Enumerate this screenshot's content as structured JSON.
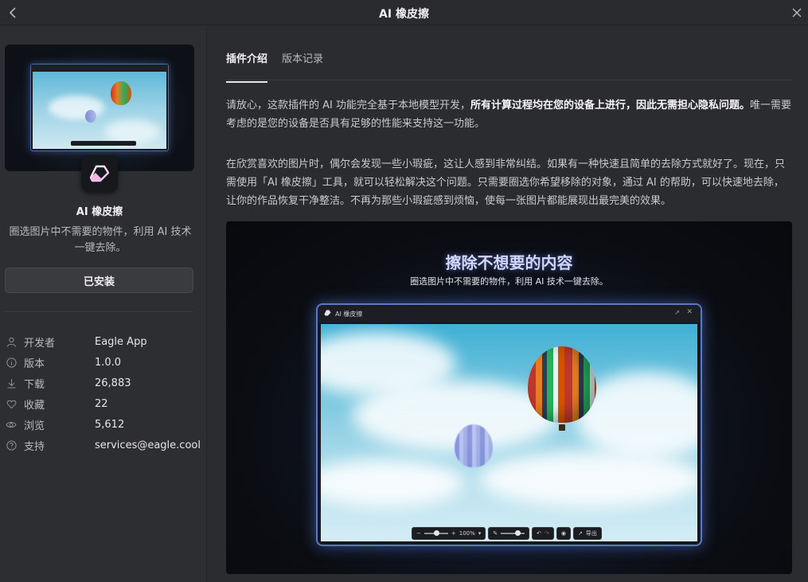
{
  "window": {
    "title": "AI 橡皮擦",
    "back_icon": "chevron-left-icon",
    "close_icon": "close-icon"
  },
  "sidebar": {
    "app_name": "AI 橡皮擦",
    "app_description": "圈选图片中不需要的物件，利用 AI 技术一键去除。",
    "install_button_label": "已安装",
    "info": [
      {
        "icon": "user-icon",
        "label": "开发者",
        "value": "Eagle App"
      },
      {
        "icon": "info-icon",
        "label": "版本",
        "value": "1.0.0"
      },
      {
        "icon": "download-icon",
        "label": "下载",
        "value": "26,883"
      },
      {
        "icon": "heart-icon",
        "label": "收藏",
        "value": "22"
      },
      {
        "icon": "eye-icon",
        "label": "浏览",
        "value": "5,612"
      },
      {
        "icon": "help-icon",
        "label": "支持",
        "value": "services@eagle.cool"
      }
    ]
  },
  "main": {
    "tabs": [
      {
        "label": "插件介绍",
        "active": true
      },
      {
        "label": "版本记录",
        "active": false
      }
    ],
    "paragraph1_before": "请放心，这款插件的 AI 功能完全基于本地模型开发，",
    "paragraph1_bold": "所有计算过程均在您的设备上进行，因此无需担心隐私问题。",
    "paragraph1_after": "唯一需要考虑的是您的设备是否具有足够的性能来支持这一功能。",
    "paragraph2": "在欣赏喜欢的图片时，偶尔会发现一些小瑕疵，这让人感到非常纠结。如果有一种快速且简单的去除方式就好了。现在，只需使用「AI 橡皮擦」工具，就可以轻松解决这个问题。只需要圈选你希望移除的对象，通过 AI 的帮助，可以快速地去除，让你的作品恢复干净整洁。不再为那些小瑕疵感到烦恼，使每一张图片都能展现出最完美的效果。",
    "promo": {
      "title": "擦除不想要的内容",
      "subtitle": "圈选图片中不需要的物件，利用 AI 技术一键去除。",
      "window_title": "AI 橡皮擦",
      "zoom": "100%",
      "export_label": "导出"
    }
  },
  "colors": {
    "background": "#2b2c2f",
    "accent_glow": "#5b78c4"
  }
}
